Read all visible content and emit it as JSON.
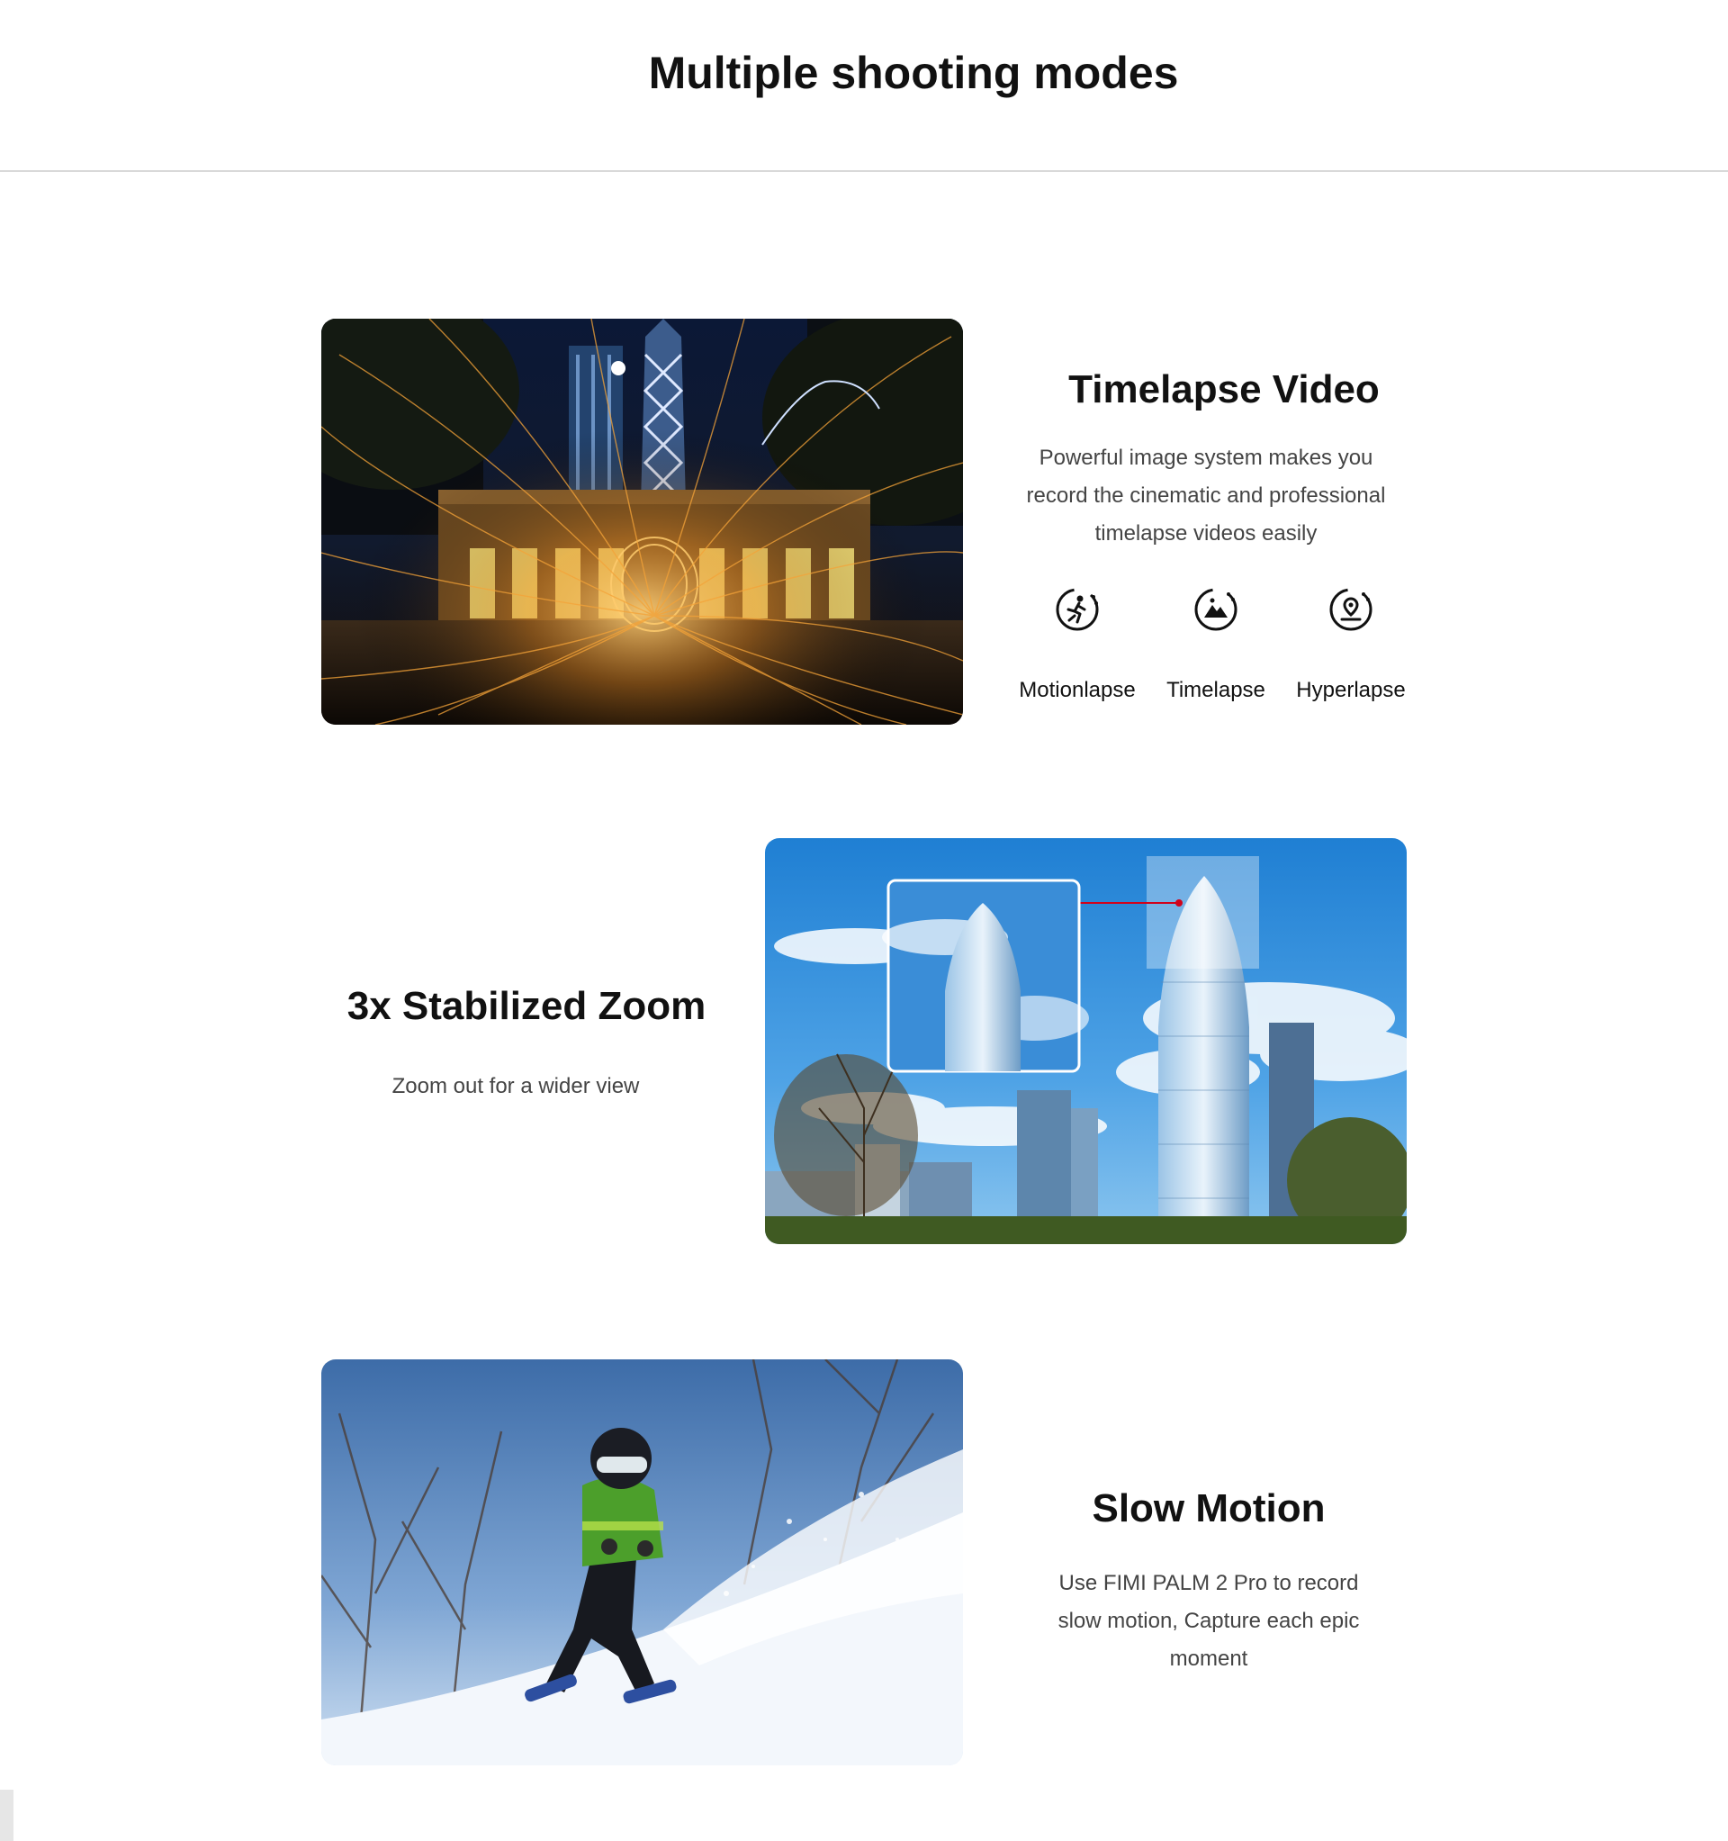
{
  "page": {
    "title": "Multiple shooting modes"
  },
  "sections": [
    {
      "heading": "Timelapse Video",
      "description_lines": [
        "Powerful image system makes you",
        "record the cinematic and professional",
        "timelapse videos easily"
      ],
      "image": "steel-wool-fire-night-city-photo",
      "modes": [
        {
          "label": "Motionlapse",
          "icon": "motionlapse-icon"
        },
        {
          "label": "Timelapse",
          "icon": "timelapse-icon"
        },
        {
          "label": "Hyperlapse",
          "icon": "hyperlapse-icon"
        }
      ]
    },
    {
      "heading": "3x Stabilized Zoom",
      "description_lines": [
        "Zoom out for a wider view"
      ],
      "image": "skyscraper-zoom-photo"
    },
    {
      "heading": "Slow Motion",
      "description_lines": [
        "Use FIMI PALM 2 Pro to record",
        "slow motion, Capture each epic",
        "moment"
      ],
      "image": "child-skiing-photo"
    }
  ],
  "colors": {
    "heading": "#111111",
    "body_text": "#444444",
    "divider": "#d9d9d9",
    "zoom_marker": "#d0021b"
  }
}
